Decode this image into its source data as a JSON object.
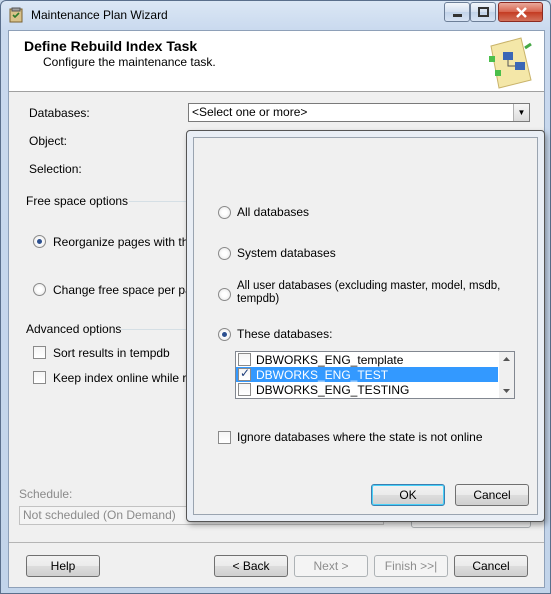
{
  "window": {
    "title": "Maintenance Plan Wizard"
  },
  "header": {
    "title": "Define Rebuild Index Task",
    "subtitle": "Configure the maintenance task."
  },
  "form": {
    "databases_label": "Databases:",
    "databases_value": "<Select one or more>",
    "object_label": "Object:",
    "selection_label": "Selection:",
    "free_space_title": "Free space options",
    "reorganize_label": "Reorganize pages with the d",
    "change_free_space_label": "Change free space per page",
    "advanced_title": "Advanced options",
    "sort_results_label": "Sort results in tempdb",
    "keep_online_label": "Keep index online while reind",
    "schedule_label": "Schedule:",
    "schedule_value": "Not scheduled (On Demand)"
  },
  "popup": {
    "all_databases": "All databases",
    "system_databases": "System databases",
    "all_user_databases_line1": "All user databases  (excluding master, model, msdb,",
    "all_user_databases_line2": "tempdb)",
    "these_databases": "These databases:",
    "database_list": [
      {
        "name": "DBWORKS_ENG_template",
        "checked": false,
        "selected": false
      },
      {
        "name": "DBWORKS_ENG_TEST",
        "checked": true,
        "selected": true
      },
      {
        "name": "DBWORKS_ENG_TESTING",
        "checked": false,
        "selected": false
      }
    ],
    "ignore_state_label": "Ignore databases where the state is not online",
    "ok": "OK",
    "cancel": "Cancel"
  },
  "footer": {
    "help": "Help",
    "back": "< Back",
    "next": "Next >",
    "finish": "Finish >>|",
    "cancel": "Cancel"
  }
}
